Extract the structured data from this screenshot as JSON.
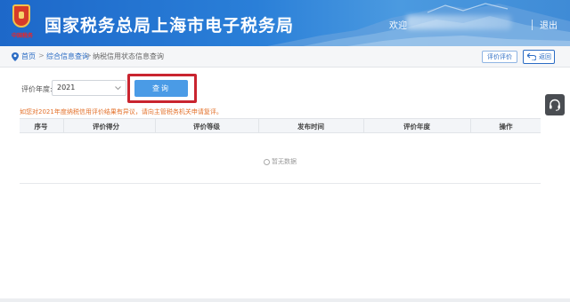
{
  "header": {
    "logo_text": "中国税务",
    "title": "国家税务总局上海市电子税务局",
    "welcome": "欢迎",
    "logout": "退出"
  },
  "breadcrumb": {
    "home": "首页",
    "separator": ">",
    "middle": "综合信息查询",
    "current": "纳税信用状态信息查询",
    "eval_button": "评价评价",
    "back_button": "返回"
  },
  "form": {
    "year_label": "评价年度:",
    "year_value": "2021",
    "query_button": "查询"
  },
  "notice": "如您对2021年度纳税信用评价结果有异议，请向主管税务机关申请复评。",
  "table": {
    "columns": [
      "序号",
      "评价得分",
      "评价等级",
      "发布时间",
      "评价年度",
      "操作"
    ],
    "empty_text": "暂无数据"
  },
  "colors": {
    "header_blue": "#1d68c9",
    "link_blue": "#2b6cc4",
    "button_blue": "#4a9be6",
    "highlight_red": "#c9242f",
    "notice_orange": "#e3702a"
  },
  "icons": {
    "pin": "location-pin-icon",
    "back": "back-arrow-icon",
    "chevron": "chevron-down-icon",
    "headset": "headset-icon",
    "empty": "info-circle-icon"
  }
}
